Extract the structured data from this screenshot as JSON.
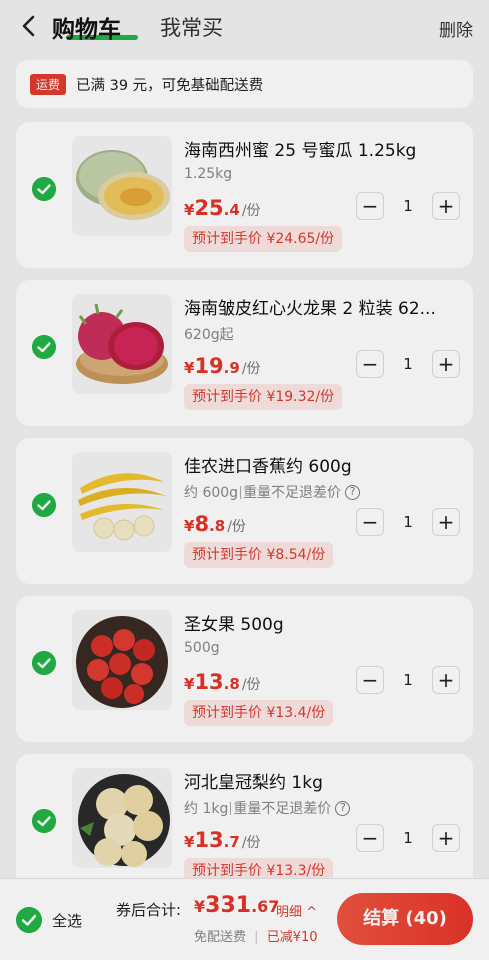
{
  "header": {
    "tab_cart": "购物车",
    "tab_often": "我常买",
    "delete_label": "删除"
  },
  "shipping": {
    "tag": "运费",
    "text": "已满 39 元，可免基础配送费"
  },
  "items": [
    {
      "title": "海南西州蜜 25 号蜜瓜 1.25kg",
      "spec": "1.25kg",
      "spec_note": "",
      "price_cur": "¥",
      "price_int": "25",
      "price_dec": ".4",
      "price_unit": "/份",
      "estimate": "预计到手价 ¥24.65/份",
      "qty": "1",
      "image": "melon"
    },
    {
      "title": "海南皱皮红心火龙果 2 粒装 62...",
      "spec": "620g起",
      "spec_note": "",
      "price_cur": "¥",
      "price_int": "19",
      "price_dec": ".9",
      "price_unit": "/份",
      "estimate": "预计到手价 ¥19.32/份",
      "qty": "1",
      "image": "dragonfruit"
    },
    {
      "title": "佳农进口香蕉约 600g",
      "spec": "约 600g",
      "spec_note": "重量不足退差价",
      "price_cur": "¥",
      "price_int": "8",
      "price_dec": ".8",
      "price_unit": "/份",
      "estimate": "预计到手价 ¥8.54/份",
      "qty": "1",
      "image": "banana"
    },
    {
      "title": "圣女果 500g",
      "spec": "500g",
      "spec_note": "",
      "price_cur": "¥",
      "price_int": "13",
      "price_dec": ".8",
      "price_unit": "/份",
      "estimate": "预计到手价 ¥13.4/份",
      "qty": "1",
      "image": "cherry-tomato"
    },
    {
      "title": "河北皇冠梨约 1kg",
      "spec": "约 1kg",
      "spec_note": "重量不足退差价",
      "price_cur": "¥",
      "price_int": "13",
      "price_dec": ".7",
      "price_unit": "/份",
      "estimate": "预计到手价 ¥13.3/份",
      "qty": "1",
      "image": "pear"
    }
  ],
  "stepper": {
    "minus": "−",
    "plus": "+"
  },
  "footer": {
    "select_all": "全选",
    "total_label": "券后合计:",
    "total_cur": "¥",
    "total_int": "331",
    "total_dec": ".67",
    "detail": "明细 ^",
    "free_shipping": "免配送费",
    "discount": "已减¥10",
    "checkout": "结算 (40)"
  },
  "colors": {
    "accent_green": "#23b347",
    "price_red": "#e63327",
    "button_red": "#e8352b"
  }
}
